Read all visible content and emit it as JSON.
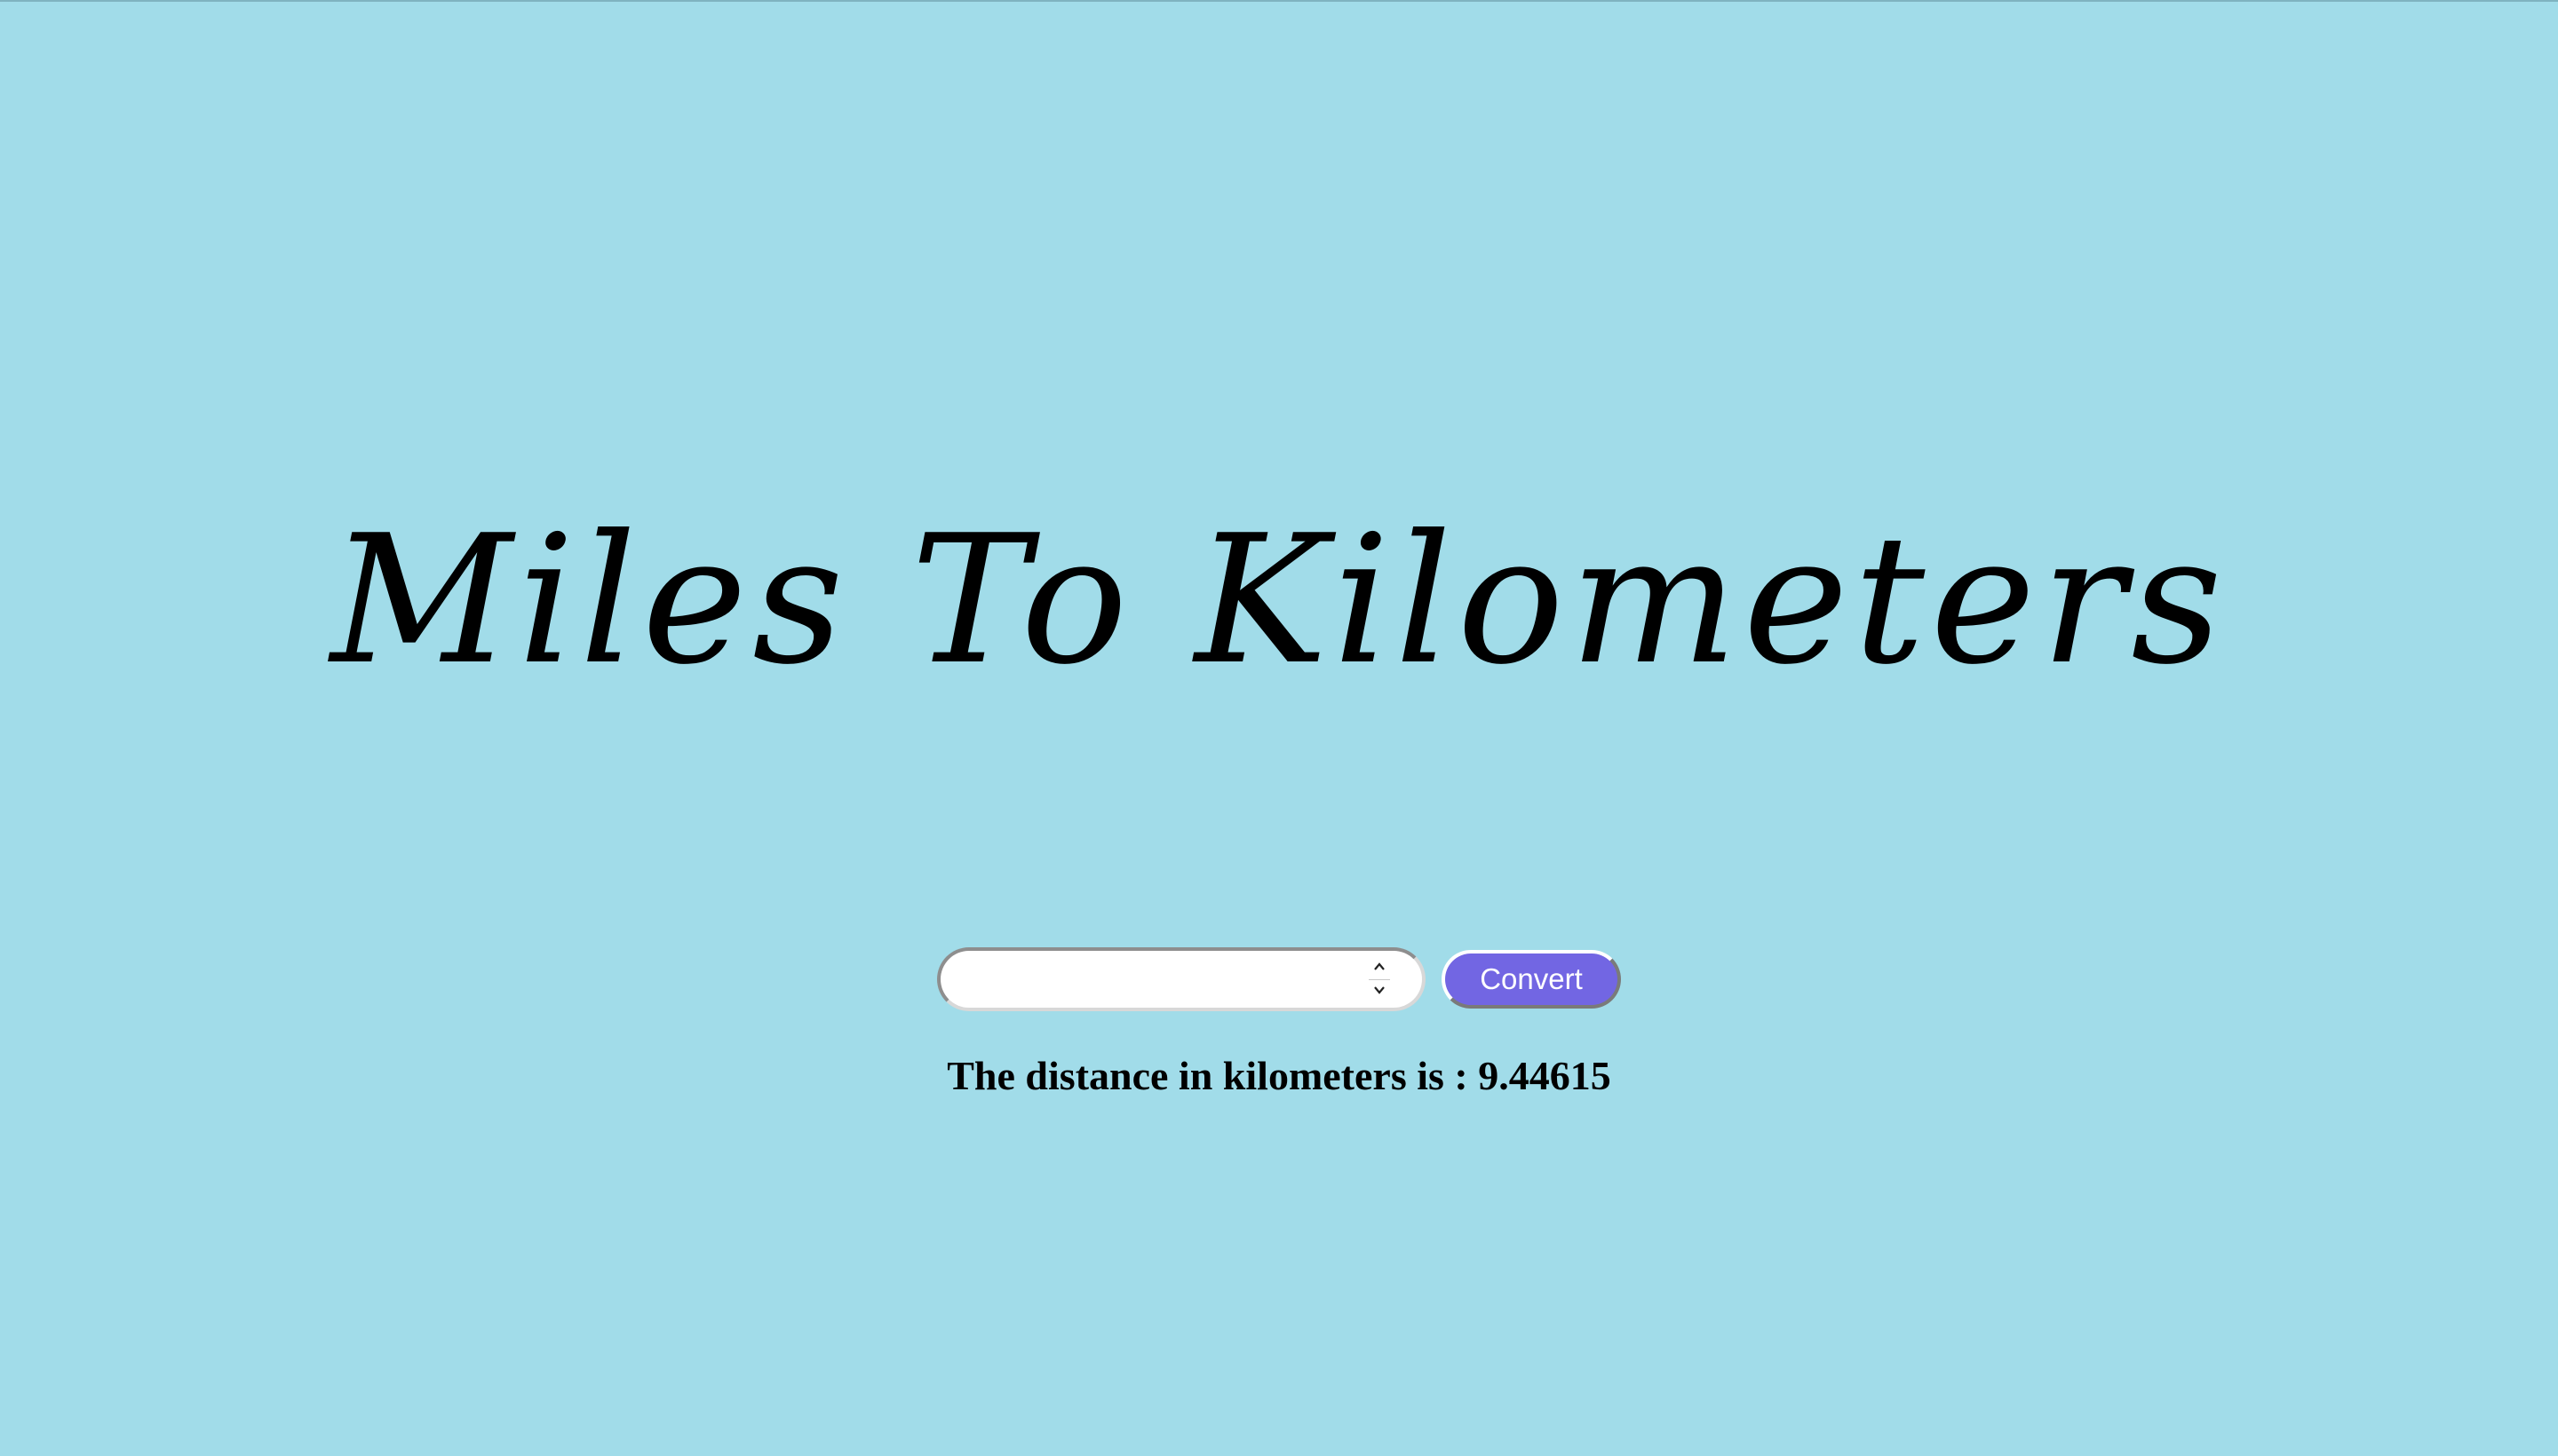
{
  "page": {
    "title": "Miles To Kilometers",
    "background_color": "#a1dce9"
  },
  "converter": {
    "input_value": "",
    "spinner_up_icon": "chevron-up-icon",
    "spinner_down_icon": "chevron-down-icon",
    "button_label": "Convert",
    "button_color": "#7266e3"
  },
  "result": {
    "text": "The distance in kilometers is : 9.44615"
  }
}
